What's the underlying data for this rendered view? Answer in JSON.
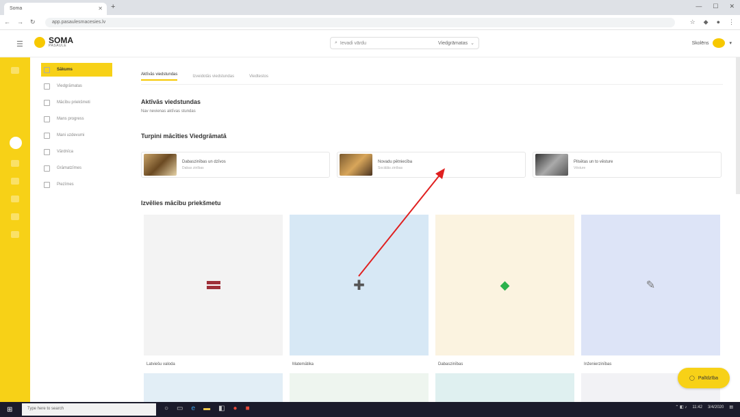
{
  "browser": {
    "tab_title": "Soma",
    "url": "app.pasaulesmacesies.lv",
    "new_tab": "+"
  },
  "header": {
    "logo_title": "SOMA",
    "logo_subtitle": "PASAULE",
    "search_placeholder": "Ievadi vārdu",
    "search_filter": "Viedgrāmatas",
    "user_name": "Skolēns",
    "colors": {
      "accent": "#f7d117"
    }
  },
  "subnav": {
    "items": [
      {
        "label": "Sākums",
        "icon": "home-icon",
        "active": true
      },
      {
        "label": "Viedgrāmatas",
        "icon": "book-icon"
      },
      {
        "label": "Mācību priekšmeti",
        "icon": "subjects-icon"
      },
      {
        "label": "Mans progress",
        "icon": "progress-icon"
      },
      {
        "label": "Mani uzdevumi",
        "icon": "tasks-icon"
      },
      {
        "label": "Vārdnīca",
        "icon": "dictionary-icon"
      },
      {
        "label": "Grāmatzīmes",
        "icon": "bookmark-icon"
      },
      {
        "label": "Piezīmes",
        "icon": "notes-icon"
      }
    ]
  },
  "main": {
    "tabs": [
      {
        "label": "Aktīvās viedstundas",
        "active": true
      },
      {
        "label": "Izveidotās viedstundas"
      },
      {
        "label": "Viedtestos"
      }
    ],
    "active_section_title": "Aktīvās viedstundas",
    "active_section_text": "Nav nevienas aktīvas stundas",
    "suggested_title": "Turpini mācīties Viedgrāmatā",
    "suggested": [
      {
        "title": "Dabaszinības un dzīvos",
        "subtitle": "Dabas zinības"
      },
      {
        "title": "Novadu pētniecība",
        "subtitle": "Sociālās zinības"
      },
      {
        "title": "Pilsētas un to vēsture",
        "subtitle": "Vēsture"
      }
    ],
    "browse_title": "Izvēlies mācību priekšmetu",
    "subjects": [
      {
        "label": "Latviešu valoda",
        "icon": "latvian-flag-icon",
        "color": "#f3f3f3"
      },
      {
        "label": "Matemātika",
        "icon": "math-cross-icon",
        "color": "#d7e8f5"
      },
      {
        "label": "Dabaszinības",
        "icon": "green-gem-icon",
        "color": "#fbf3e0"
      },
      {
        "label": "Inženierzinības",
        "icon": "dropper-icon",
        "color": "#dde4f7"
      }
    ],
    "subjects_row2_colors": [
      "#e2eef6",
      "#eef5ef",
      "#dff0f0",
      "#f2f2f5"
    ]
  },
  "help": {
    "label": "Palīdzība"
  },
  "taskbar": {
    "search_placeholder": "Type here to search",
    "time": "11:42",
    "date": "3/4/2020"
  }
}
